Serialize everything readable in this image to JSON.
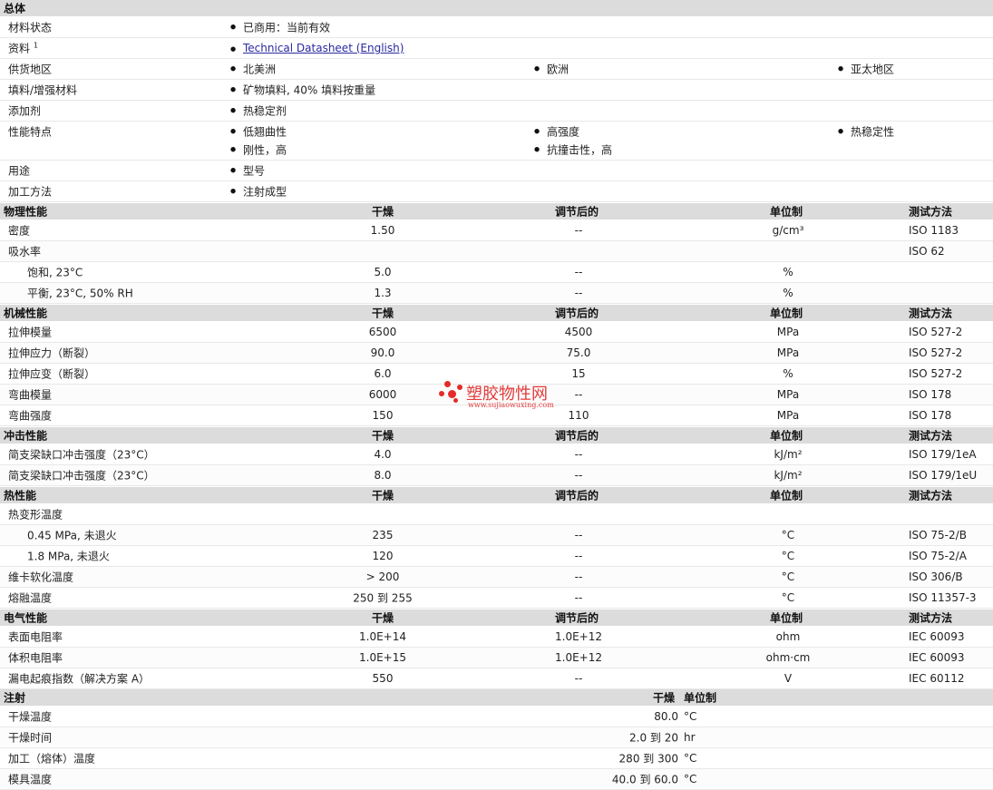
{
  "general": {
    "title": "总体",
    "status_label": "材料状态",
    "status_value": "已商用：当前有效",
    "docs_label": "资料",
    "docs_sup": "1",
    "docs_link": "Technical Datasheet (English)",
    "supply_label": "供货地区",
    "supply": [
      "北美洲",
      "欧洲",
      "亚太地区"
    ],
    "filler_label": "填料/增强材料",
    "filler_value": "矿物填料, 40% 填料按重量",
    "additive_label": "添加剂",
    "additive_value": "热稳定剂",
    "features_label": "性能特点",
    "features": [
      "低翘曲性",
      "高强度",
      "热稳定性",
      "刚性，高",
      "抗撞击性，高"
    ],
    "use_label": "用途",
    "use_value": "型号",
    "process_label": "加工方法",
    "process_value": "注射成型"
  },
  "cols": {
    "dry": "干燥",
    "cond": "调节后的",
    "unit": "单位制",
    "method": "测试方法"
  },
  "physical": {
    "title": "物理性能",
    "rows": [
      {
        "name": "密度",
        "dry": "1.50",
        "cond": "--",
        "unit": "g/cm³",
        "method": "ISO 1183"
      },
      {
        "name": "吸水率",
        "dry": "",
        "cond": "",
        "unit": "",
        "method": "ISO 62"
      },
      {
        "name": "饱和, 23°C",
        "dry": "5.0",
        "cond": "--",
        "unit": "%",
        "method": ""
      },
      {
        "name": "平衡, 23°C, 50% RH",
        "dry": "1.3",
        "cond": "--",
        "unit": "%",
        "method": ""
      }
    ]
  },
  "mechanical": {
    "title": "机械性能",
    "rows": [
      {
        "name": "拉伸模量",
        "dry": "6500",
        "cond": "4500",
        "unit": "MPa",
        "method": "ISO 527-2"
      },
      {
        "name": "拉伸应力（断裂）",
        "dry": "90.0",
        "cond": "75.0",
        "unit": "MPa",
        "method": "ISO 527-2"
      },
      {
        "name": "拉伸应变（断裂）",
        "dry": "6.0",
        "cond": "15",
        "unit": "%",
        "method": "ISO 527-2"
      },
      {
        "name": "弯曲模量",
        "dry": "6000",
        "cond": "--",
        "unit": "MPa",
        "method": "ISO 178"
      },
      {
        "name": "弯曲强度",
        "dry": "150",
        "cond": "110",
        "unit": "MPa",
        "method": "ISO 178"
      }
    ]
  },
  "impact": {
    "title": "冲击性能",
    "rows": [
      {
        "name": "简支梁缺口冲击强度（23°C）",
        "dry": "4.0",
        "cond": "--",
        "unit": "kJ/m²",
        "method": "ISO 179/1eA"
      },
      {
        "name": "简支梁缺口冲击强度（23°C）",
        "dry": "8.0",
        "cond": "--",
        "unit": "kJ/m²",
        "method": "ISO 179/1eU"
      }
    ]
  },
  "thermal": {
    "title": "热性能",
    "rows": [
      {
        "name": "热变形温度",
        "dry": "",
        "cond": "",
        "unit": "",
        "method": ""
      },
      {
        "name": "0.45 MPa, 未退火",
        "dry": "235",
        "cond": "--",
        "unit": "°C",
        "method": "ISO 75-2/B"
      },
      {
        "name": "1.8 MPa, 未退火",
        "dry": "120",
        "cond": "--",
        "unit": "°C",
        "method": "ISO 75-2/A"
      },
      {
        "name": "维卡软化温度",
        "dry": "> 200",
        "cond": "--",
        "unit": "°C",
        "method": "ISO 306/B"
      },
      {
        "name": "熔融温度",
        "dry": "250 到  255",
        "cond": "--",
        "unit": "°C",
        "method": "ISO 11357-3"
      }
    ]
  },
  "electrical": {
    "title": "电气性能",
    "rows": [
      {
        "name": "表面电阻率",
        "dry": "1.0E+14",
        "cond": "1.0E+12",
        "unit": "ohm",
        "method": "IEC 60093"
      },
      {
        "name": "体积电阻率",
        "dry": "1.0E+15",
        "cond": "1.0E+12",
        "unit": "ohm·cm",
        "method": "IEC 60093"
      },
      {
        "name": "漏电起痕指数（解决方案 A）",
        "dry": "550",
        "cond": "--",
        "unit": "V",
        "method": "IEC 60112"
      }
    ]
  },
  "injection": {
    "title": "注射",
    "dry": "干燥",
    "unit": "单位制",
    "rows": [
      {
        "name": "干燥温度",
        "value": "80.0",
        "unit": "°C"
      },
      {
        "name": "干燥时间",
        "value": "2.0 到  20",
        "unit": "hr"
      },
      {
        "name": "加工（熔体）温度",
        "value": "280 到  300",
        "unit": "°C"
      },
      {
        "name": "模具温度",
        "value": "40.0 到  60.0",
        "unit": "°C"
      }
    ]
  },
  "watermark": {
    "text": "塑胶物性网",
    "url": "www.sujiaowuxing.com"
  }
}
